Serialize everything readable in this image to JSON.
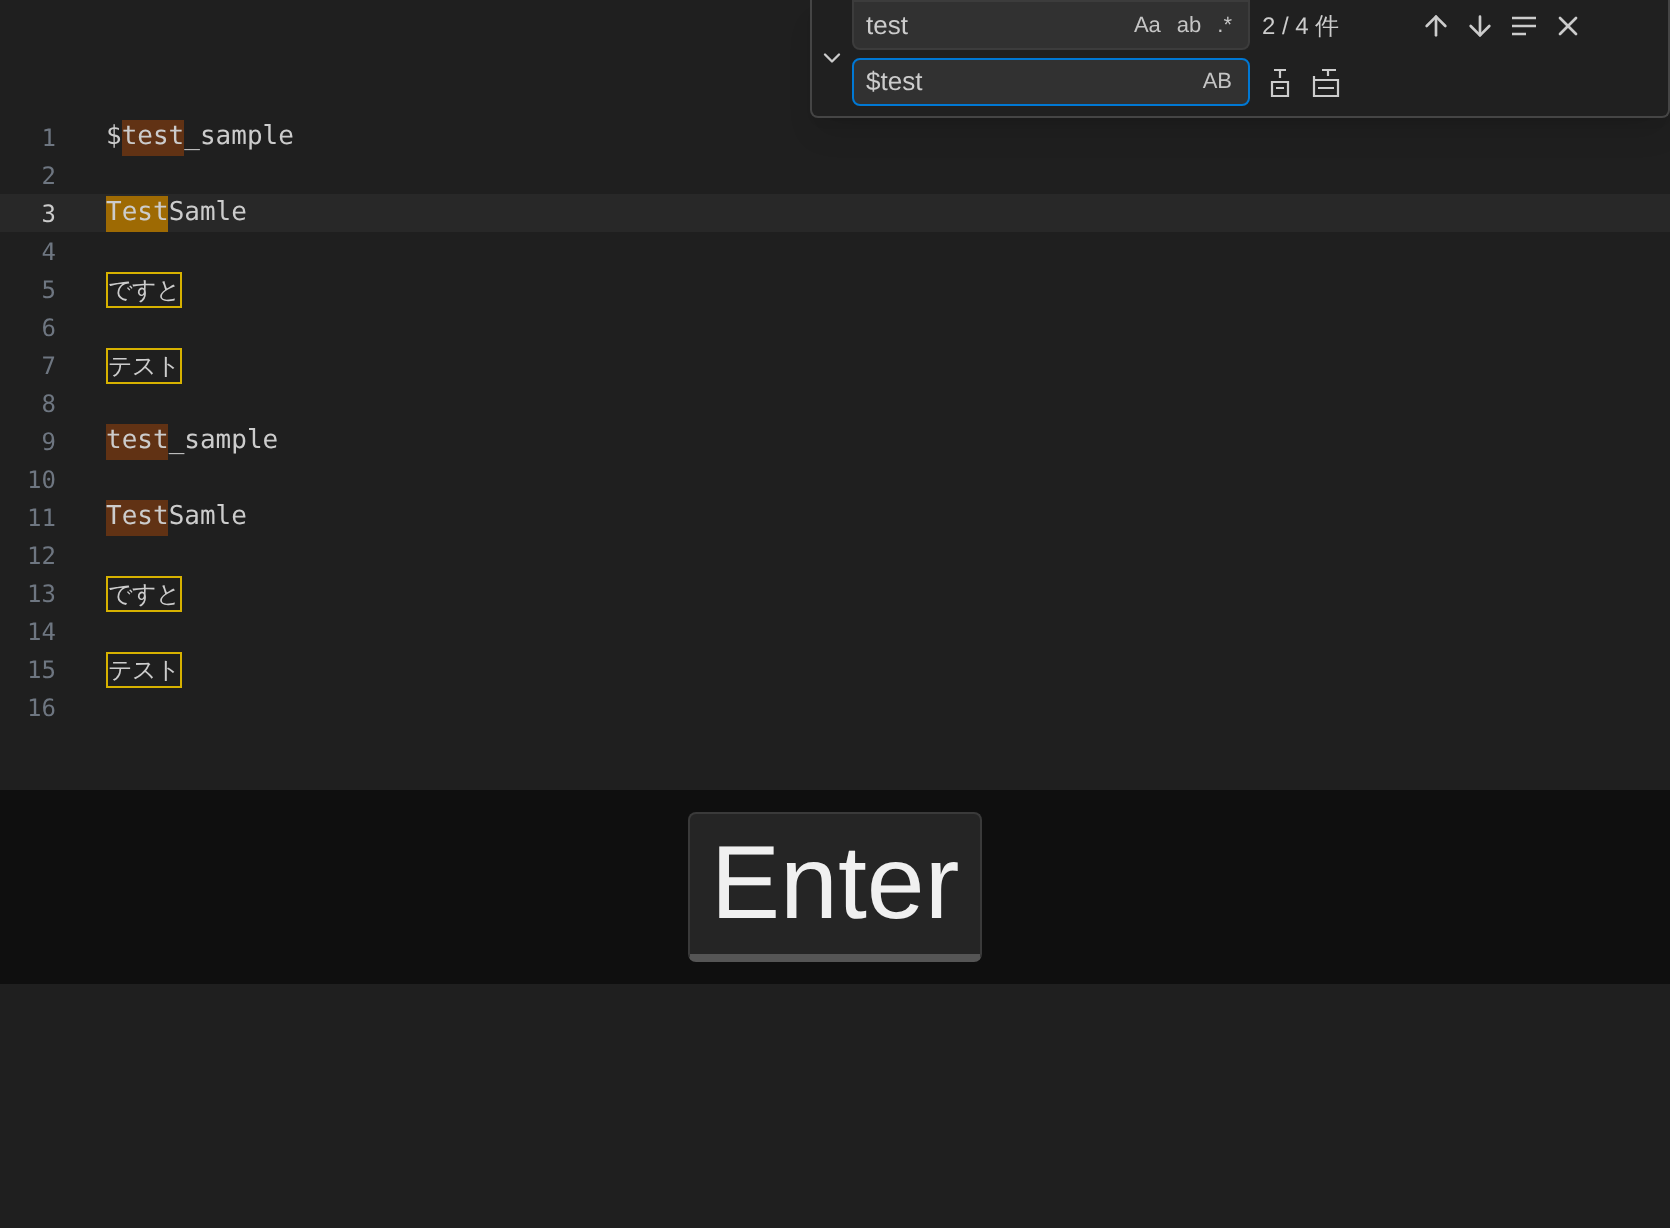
{
  "editor": {
    "lines": [
      {
        "number": "1",
        "current": false,
        "segments": [
          {
            "text": "$",
            "kind": "plain"
          },
          {
            "text": "test",
            "kind": "match"
          },
          {
            "text": "_sample",
            "kind": "plain"
          }
        ]
      },
      {
        "number": "2",
        "current": false
      },
      {
        "number": "3",
        "current": true,
        "segments": [
          {
            "text": "Test",
            "kind": "current"
          },
          {
            "text": "Samle",
            "kind": "plain"
          }
        ]
      },
      {
        "number": "4",
        "current": false
      },
      {
        "number": "5",
        "current": false,
        "segments": [
          {
            "text": "ですと",
            "kind": "boxed"
          }
        ]
      },
      {
        "number": "6",
        "current": false
      },
      {
        "number": "7",
        "current": false,
        "segments": [
          {
            "text": "テスト",
            "kind": "boxed"
          }
        ]
      },
      {
        "number": "8",
        "current": false
      },
      {
        "number": "9",
        "current": false,
        "segments": [
          {
            "text": "test",
            "kind": "match"
          },
          {
            "text": "_sample",
            "kind": "plain"
          }
        ]
      },
      {
        "number": "10",
        "current": false
      },
      {
        "number": "11",
        "current": false,
        "segments": [
          {
            "text": "Test",
            "kind": "match"
          },
          {
            "text": "Samle",
            "kind": "plain"
          }
        ]
      },
      {
        "number": "12",
        "current": false
      },
      {
        "number": "13",
        "current": false,
        "segments": [
          {
            "text": "ですと",
            "kind": "boxed"
          }
        ]
      },
      {
        "number": "14",
        "current": false
      },
      {
        "number": "15",
        "current": false,
        "segments": [
          {
            "text": "テスト",
            "kind": "boxed"
          }
        ]
      },
      {
        "number": "16",
        "current": false
      }
    ]
  },
  "find_widget": {
    "expanded": true,
    "find_field": {
      "value": "test",
      "toggles": [
        {
          "label": "Aa",
          "on": false
        },
        {
          "label": "ab",
          "on": false
        },
        {
          "label": ".*",
          "on": false
        }
      ]
    },
    "match_count": "2 / 4 件",
    "replace_field": {
      "value": "$test",
      "toggles": [
        {
          "label": "AB",
          "on": false
        }
      ]
    }
  },
  "key_overlay": {
    "key": "Enter"
  }
}
